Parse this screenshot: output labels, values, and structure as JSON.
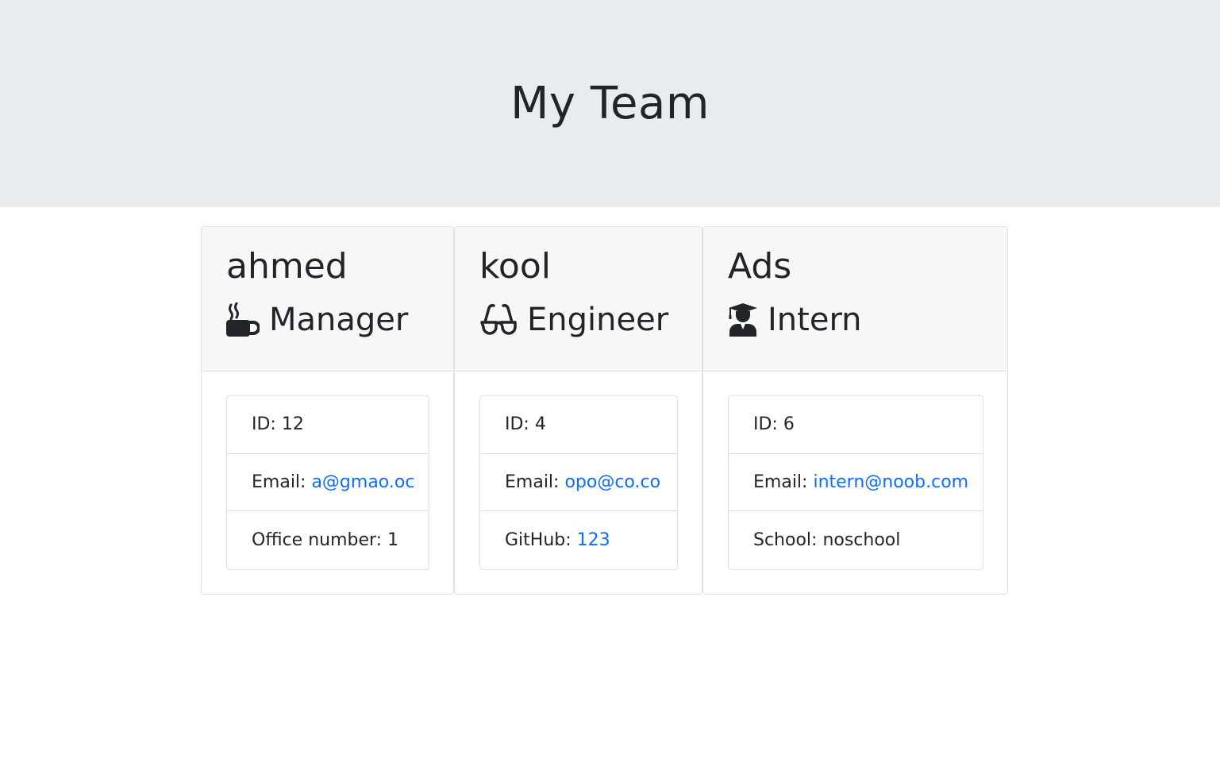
{
  "header": {
    "title": "My Team"
  },
  "team": [
    {
      "name": "ahmed",
      "role": "Manager",
      "role_icon": "mug-hot-icon",
      "id_label": "ID: 12",
      "email_label": "Email:",
      "email": "a@gmao.oc",
      "extra_label": "Office number: 1"
    },
    {
      "name": "kool",
      "role": "Engineer",
      "role_icon": "glasses-icon",
      "id_label": "ID: 4",
      "email_label": "Email:",
      "email": "opo@co.co",
      "extra_label": "GitHub:",
      "extra_link": "123"
    },
    {
      "name": "Ads",
      "role": "Intern",
      "role_icon": "user-graduate-icon",
      "id_label": "ID: 6",
      "email_label": "Email:",
      "email": "intern@noob.com",
      "extra_label": "School: noschool"
    }
  ],
  "colors": {
    "header_bg": "#e9ecef",
    "link": "#0d6efd",
    "text": "#212529"
  }
}
